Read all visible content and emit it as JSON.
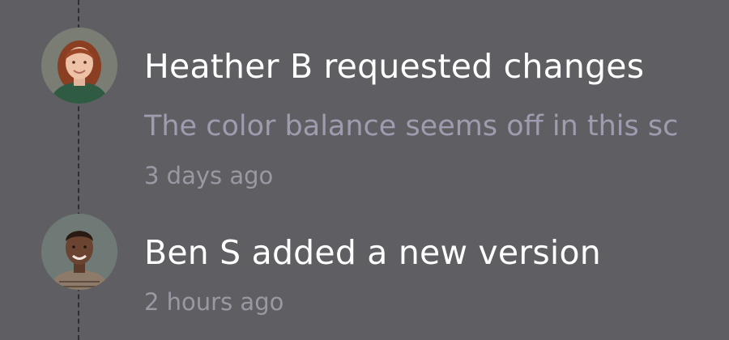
{
  "activity": [
    {
      "author": "Heather B",
      "title": "Heather B requested changes",
      "comment": "The color balance seems off in this sc",
      "time": "3 days ago",
      "avatar_icon": "person-avatar"
    },
    {
      "author": "Ben S",
      "title": "Ben S added a new version",
      "time": "2 hours ago",
      "avatar_icon": "person-avatar"
    }
  ],
  "colors": {
    "background": "#5f5e63",
    "title": "#ffffff",
    "muted": "#9e9cae",
    "timeline": "#2f2e33"
  }
}
